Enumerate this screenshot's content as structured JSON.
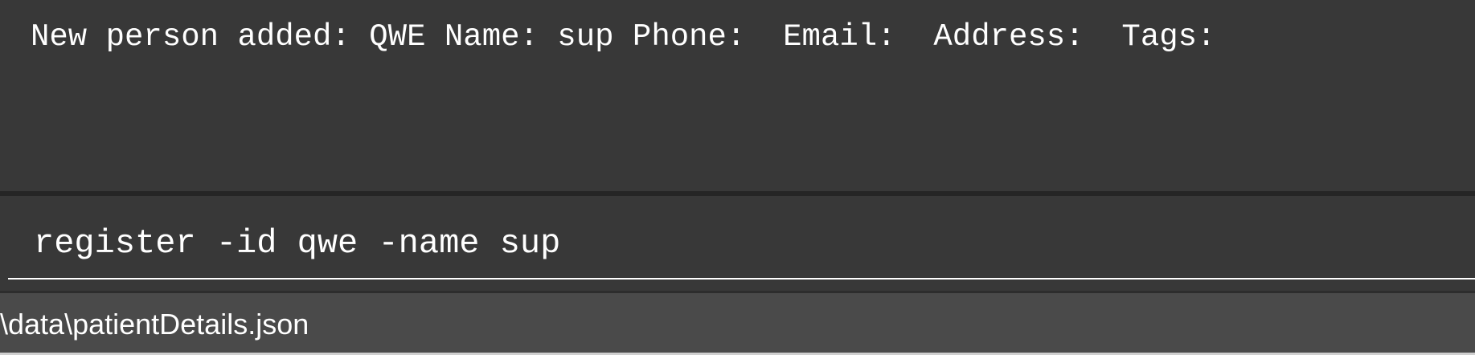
{
  "result_display": {
    "text": "New person added: QWE Name: sup Phone:  Email:  Address:  Tags:"
  },
  "command_box": {
    "value": "register -id qwe -name sup"
  },
  "status_bar": {
    "save_location": "\\data\\patientDetails.json"
  },
  "colors": {
    "background": "#383838",
    "status_bar": "#4a4a4a",
    "text": "#ffffff"
  }
}
